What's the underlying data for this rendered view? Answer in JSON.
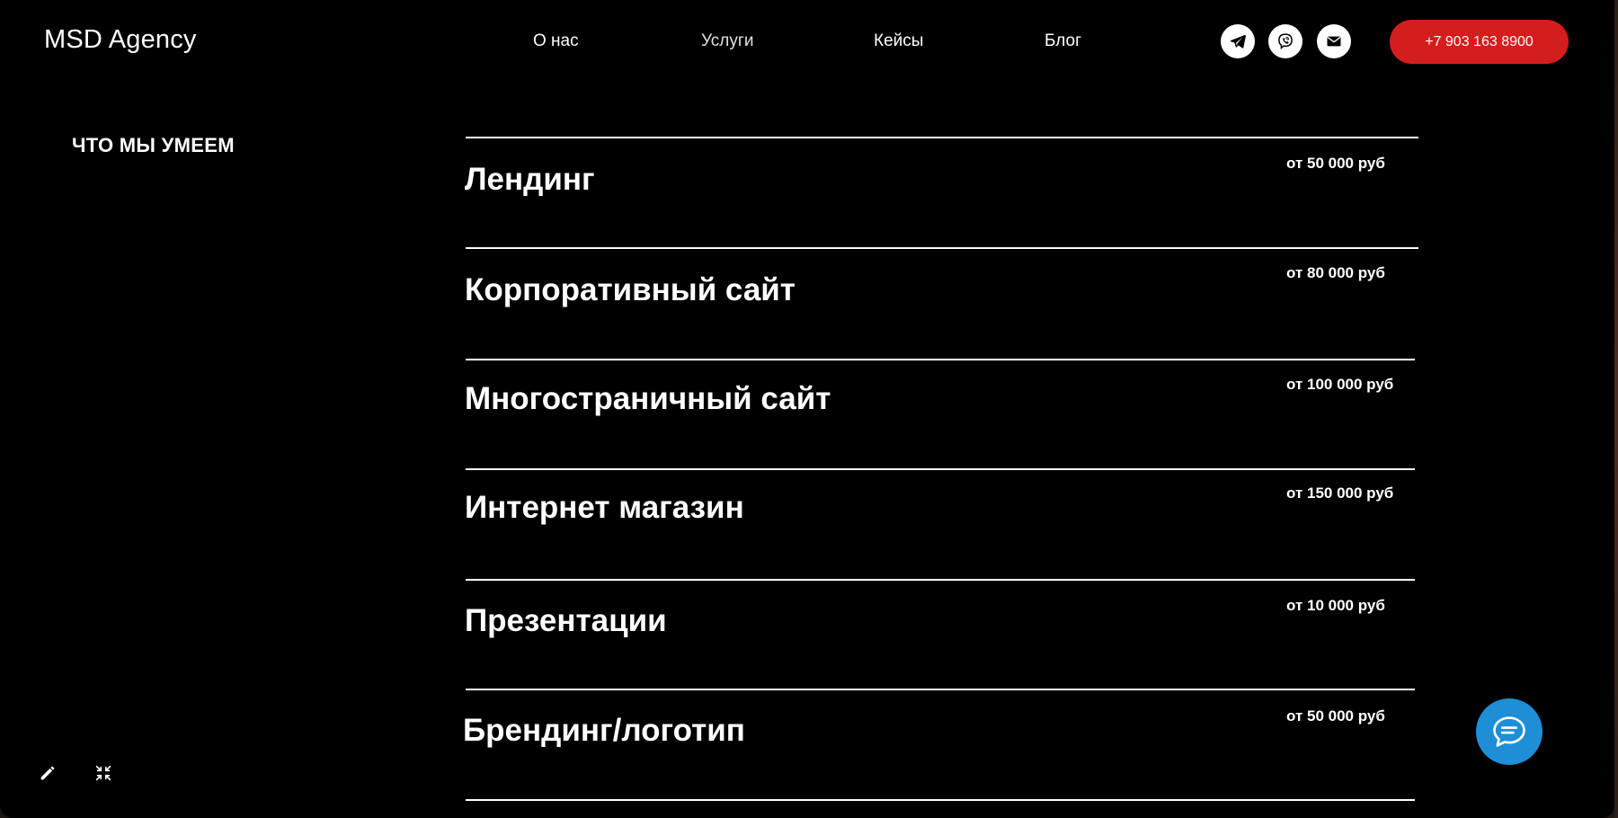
{
  "header": {
    "logo": "MSD Agency",
    "nav": [
      {
        "label": "О нас"
      },
      {
        "label": "Услуги"
      },
      {
        "label": "Кейсы"
      },
      {
        "label": "Блог"
      }
    ],
    "icons": [
      "telegram-icon",
      "viber-icon",
      "mail-icon"
    ],
    "phone_label": "+7 903 163 8900",
    "accent_color": "#d41d1d"
  },
  "section": {
    "title": "ЧТО МЫ УМЕЕМ"
  },
  "services": [
    {
      "name": "Лендинг",
      "price": "от 50 000 руб"
    },
    {
      "name": "Корпоративный сайт",
      "price": "от 80 000 руб"
    },
    {
      "name": "Многостраничный сайт",
      "price": "от 100 000 руб"
    },
    {
      "name": "Интернет магазин",
      "price": "от 150 000 руб"
    },
    {
      "name": "Презентации",
      "price": "от 10 000 руб"
    },
    {
      "name": "Брендинг/логотип",
      "price": "от 50 000 руб"
    }
  ],
  "tools": [
    "pencil-icon",
    "collapse-icon"
  ],
  "chat": {
    "icon": "chat-icon",
    "color": "#1e8fd6"
  }
}
